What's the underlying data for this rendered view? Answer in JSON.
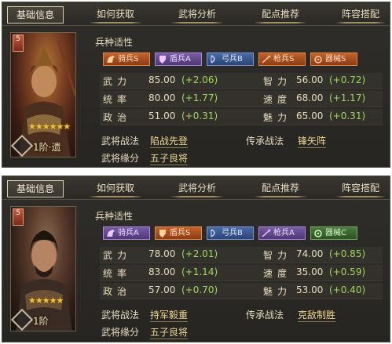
{
  "panels": [
    {
      "tabs": [
        "基础信息",
        "如何获取",
        "武将分析",
        "配点推荐",
        "阵容搭配"
      ],
      "portrait": {
        "badge": "5",
        "star_label": "1阶·遗",
        "stars": "★★★★★★",
        "star_count": 6
      },
      "troop_title": "兵种适性",
      "troops": [
        {
          "label": "骑兵S",
          "grade": "s",
          "icon": "horse-icon"
        },
        {
          "label": "盾兵A",
          "grade": "a",
          "icon": "shield-icon"
        },
        {
          "label": "弓兵B",
          "grade": "b",
          "icon": "bow-icon"
        },
        {
          "label": "枪兵S",
          "grade": "s",
          "icon": "spear-icon"
        },
        {
          "label": "器械S",
          "grade": "s",
          "icon": "siege-icon"
        }
      ],
      "stats": [
        {
          "name": "武力",
          "value": "85.00",
          "bonus": "(+2.06)"
        },
        {
          "name": "智力",
          "value": "56.00",
          "bonus": "(+0.72)"
        },
        {
          "name": "统率",
          "value": "80.00",
          "bonus": "(+1.77)"
        },
        {
          "name": "速度",
          "value": "68.00",
          "bonus": "(+1.17)"
        },
        {
          "name": "政治",
          "value": "51.00",
          "bonus": "(+0.31)"
        },
        {
          "name": "魅力",
          "value": "65.00",
          "bonus": "(+0.31)"
        }
      ],
      "tactics": {
        "general_label": "武将战法",
        "general_value": "陷战先登",
        "inherit_label": "传承战法",
        "inherit_value": "锋矢阵",
        "fate_label": "武将缘分",
        "fate_value": "五子良将"
      }
    },
    {
      "tabs": [
        "基础信息",
        "如何获取",
        "武将分析",
        "配点推荐",
        "阵容搭配"
      ],
      "portrait": {
        "badge": "5",
        "star_label": "1阶",
        "stars": "★★★★★",
        "star_count": 5
      },
      "troop_title": "兵种适性",
      "troops": [
        {
          "label": "骑兵A",
          "grade": "a",
          "icon": "horse-icon"
        },
        {
          "label": "盾兵S",
          "grade": "s",
          "icon": "shield-icon"
        },
        {
          "label": "弓兵B",
          "grade": "b",
          "icon": "bow-icon"
        },
        {
          "label": "枪兵A",
          "grade": "a",
          "icon": "spear-icon"
        },
        {
          "label": "器械C",
          "grade": "c",
          "icon": "siege-icon"
        }
      ],
      "stats": [
        {
          "name": "武力",
          "value": "78.00",
          "bonus": "(+2.01)"
        },
        {
          "name": "智力",
          "value": "74.00",
          "bonus": "(+0.85)"
        },
        {
          "name": "统率",
          "value": "83.00",
          "bonus": "(+1.14)"
        },
        {
          "name": "速度",
          "value": "35.00",
          "bonus": "(+0.59)"
        },
        {
          "name": "政治",
          "value": "57.00",
          "bonus": "(+0.70)"
        },
        {
          "name": "魅力",
          "value": "53.00",
          "bonus": "(+0.40)"
        }
      ],
      "tactics": {
        "general_label": "武将战法",
        "general_value": "持军毅重",
        "inherit_label": "传承战法",
        "inherit_value": "克敌制胜",
        "fate_label": "武将缘分",
        "fate_value": "五子良将"
      }
    }
  ],
  "colors": {
    "panel_bg": "#2b2925",
    "text": "#e8dcc0",
    "bonus": "#a0d860",
    "grade_s": "#c2622a",
    "grade_a": "#7a5aa8",
    "grade_b": "#4a6aa4",
    "grade_c": "#4a7a3c"
  }
}
